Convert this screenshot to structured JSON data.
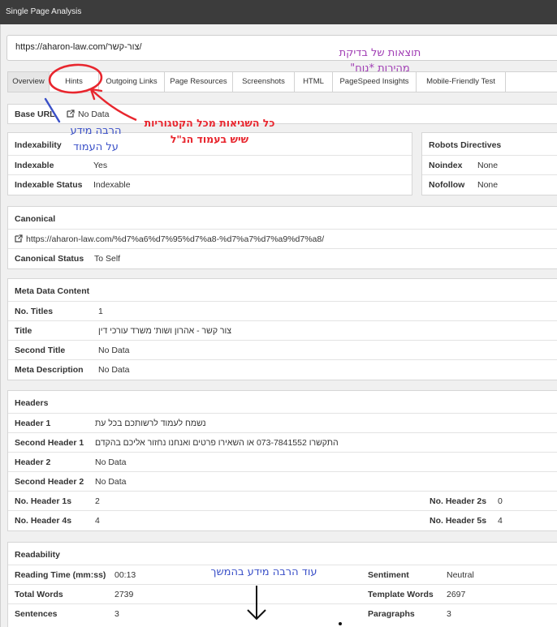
{
  "window": {
    "title": "Single Page Analysis"
  },
  "url_bar": {
    "value": "https://aharon-law.com/צור-קשר/"
  },
  "tabs": [
    {
      "label": "Overview",
      "active": true
    },
    {
      "label": "Hints"
    },
    {
      "label": "Outgoing Links"
    },
    {
      "label": "Page Resources"
    },
    {
      "label": "Screenshots"
    },
    {
      "label": "HTML"
    },
    {
      "label": "PageSpeed Insights"
    },
    {
      "label": "Mobile-Friendly Test"
    }
  ],
  "base_url": {
    "label": "Base URL",
    "value": "No Data",
    "icon": "external-link-icon"
  },
  "indexability": {
    "title": "Indexability",
    "rows": [
      {
        "label": "Indexable",
        "value": "Yes"
      },
      {
        "label": "Indexable Status",
        "value": "Indexable"
      }
    ]
  },
  "robots": {
    "title": "Robots Directives",
    "rows": [
      {
        "label": "Noindex",
        "value": "None"
      },
      {
        "label": "Nofollow",
        "value": "None"
      }
    ]
  },
  "canonical": {
    "title": "Canonical",
    "url": "https://aharon-law.com/%d7%a6%d7%95%d7%a8-%d7%a7%d7%a9%d7%a8/",
    "status_label": "Canonical Status",
    "status_value": "To Self"
  },
  "meta": {
    "title": "Meta Data Content",
    "rows": [
      {
        "label": "No. Titles",
        "value": "1"
      },
      {
        "label": "Title",
        "value": "צור קשר - אהרון ושות' משרד עורכי דין"
      },
      {
        "label": "Second Title",
        "value": "No Data"
      },
      {
        "label": "Meta Description",
        "value": "No Data"
      }
    ]
  },
  "headers": {
    "title": "Headers",
    "rows": [
      {
        "label": "Header 1",
        "value": "נשמח לעמוד לרשותכם בכל עת"
      },
      {
        "label": "Second Header 1",
        "value": "התקשרו 073-7841552 או השאירו פרטים ואנחנו נחזור אליכם בהקדם"
      },
      {
        "label": "Header 2",
        "value": "No Data"
      },
      {
        "label": "Second Header 2",
        "value": "No Data"
      }
    ],
    "split_rows": [
      {
        "left_label": "No. Header 1s",
        "left_value": "2",
        "right_label": "No. Header 2s",
        "right_value": "0"
      },
      {
        "left_label": "No. Header 4s",
        "left_value": "4",
        "right_label": "No. Header 5s",
        "right_value": "4"
      }
    ]
  },
  "readability": {
    "title": "Readability",
    "rows": [
      {
        "left_label": "Reading Time (mm:ss)",
        "left_value": "00:13",
        "right_label": "Sentiment",
        "right_value": "Neutral"
      },
      {
        "left_label": "Total Words",
        "left_value": "2739",
        "right_label": "Template Words",
        "right_value": "2697"
      },
      {
        "left_label": "Sentences",
        "left_value": "3",
        "right_label": "Paragraphs",
        "right_value": "3"
      }
    ]
  },
  "annotations": {
    "speed_line1": "תוצאות של בדיקת",
    "speed_line2": "מהירות *נוח\"",
    "hints_line1": "כל השגיאות מכל הקטגוריות",
    "hints_line2": "שיש בעמוד הנ\"ל",
    "overview_line1": "הרבה מידע",
    "overview_line2": "על העמוד",
    "more_info": "עוד הרבה מידע בהמשך",
    "colors": {
      "purple": "#a03cb4",
      "red": "#e8262e",
      "blue": "#3a50c8"
    }
  }
}
